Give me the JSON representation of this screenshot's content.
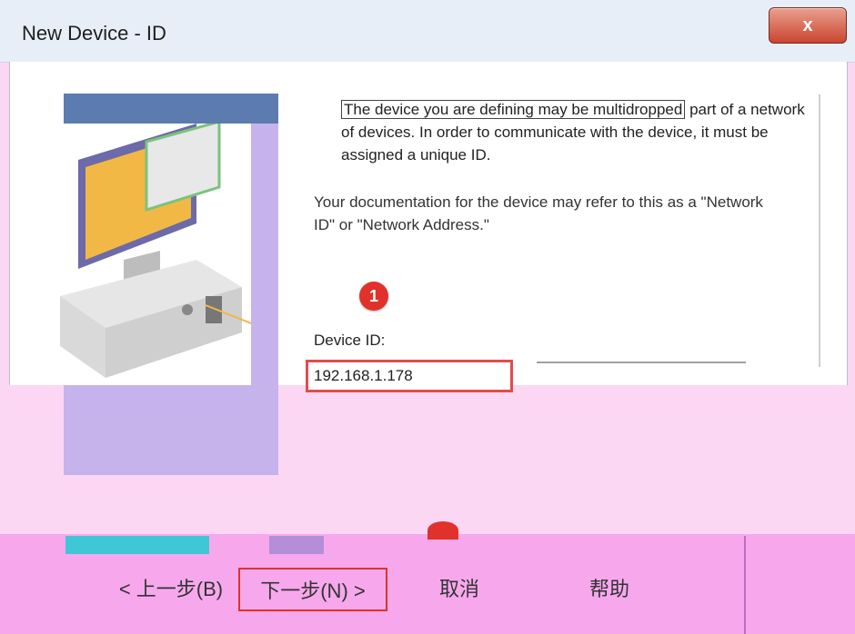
{
  "window": {
    "title": "New Device - ID",
    "close_label": "x"
  },
  "description": {
    "line1": "The device you are defining may be multidropped",
    "line1_rest": "part of a network of devices.  In order to communicate with the device, it must be assigned a unique ID.",
    "paragraph2": "Your documentation for the device may refer to this as a \"Network ID\" or \"Network Address.\""
  },
  "callouts": {
    "step1": "1"
  },
  "device_id": {
    "label": "Device ID:",
    "value": "192.168.1.178"
  },
  "buttons": {
    "back": "< 上一步(B)",
    "next": "下一步(N) >",
    "cancel": "取消",
    "help": "帮助"
  },
  "colors": {
    "accent": "#e0322b",
    "close_button": "#c9452e"
  }
}
